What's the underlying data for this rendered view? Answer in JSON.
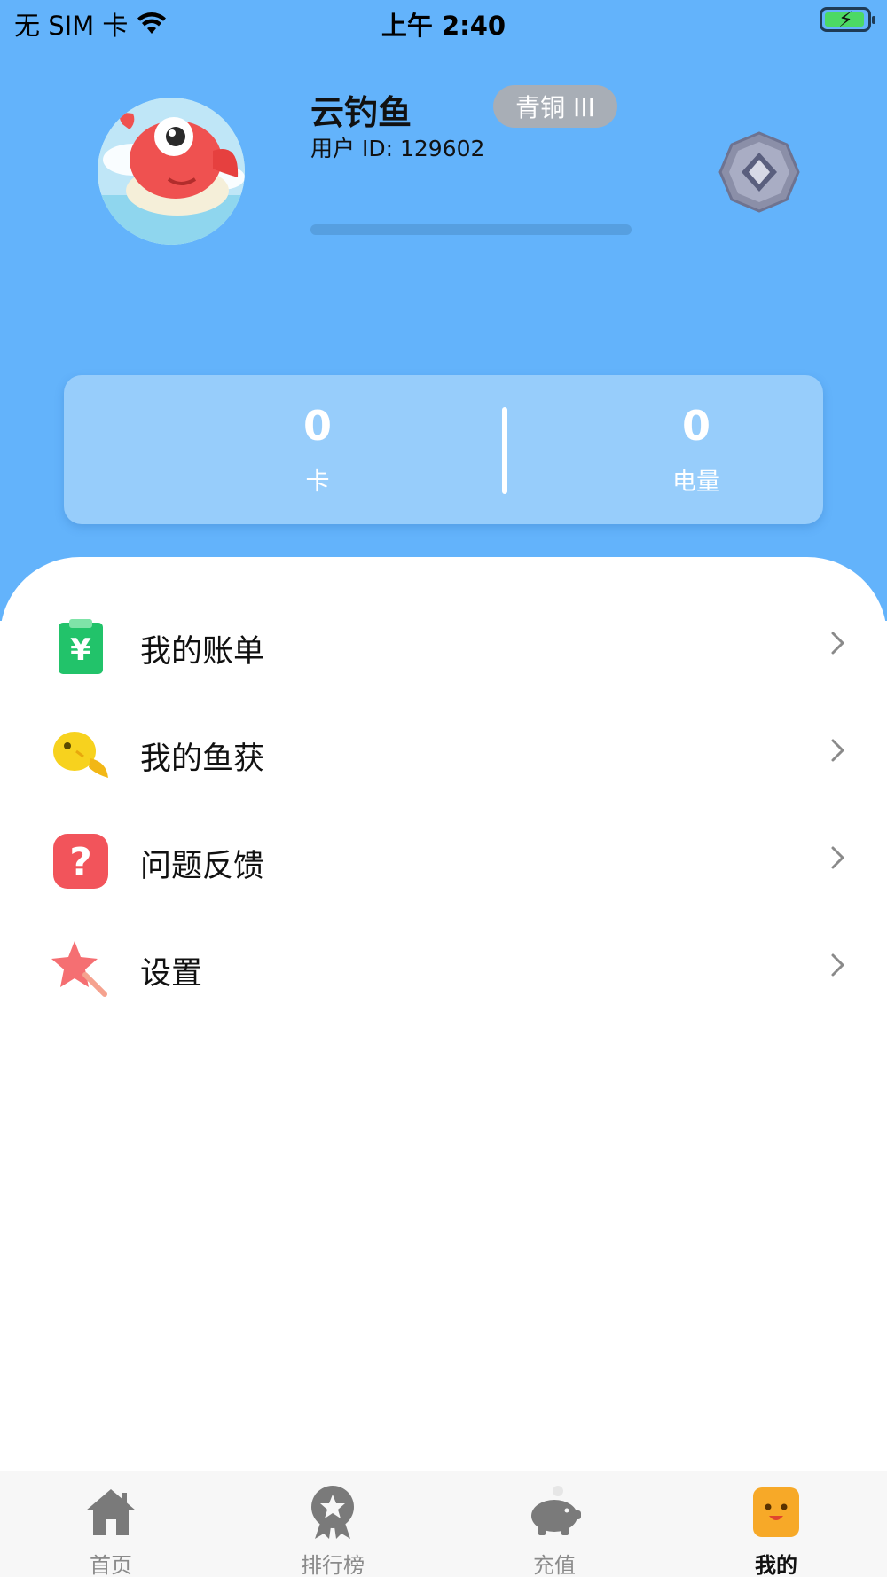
{
  "status_bar": {
    "carrier": "无 SIM 卡",
    "time": "上午 2:40"
  },
  "profile": {
    "username": "云钓鱼",
    "rank": "青铜 III",
    "user_id": "用户 ID: 129602",
    "progress": 0
  },
  "stats": [
    {
      "value": "0",
      "label": "卡"
    },
    {
      "value": "0",
      "label": "电量"
    }
  ],
  "menu": [
    {
      "label": "我的账单",
      "icon": "bill-icon"
    },
    {
      "label": "我的鱼获",
      "icon": "fish-catch-icon"
    },
    {
      "label": "问题反馈",
      "icon": "feedback-icon"
    },
    {
      "label": "设置",
      "icon": "settings-icon"
    }
  ],
  "tabs": [
    {
      "label": "首页",
      "icon": "home-icon",
      "active": false
    },
    {
      "label": "排行榜",
      "icon": "ranking-icon",
      "active": false
    },
    {
      "label": "充值",
      "icon": "piggy-bank-icon",
      "active": false
    },
    {
      "label": "我的",
      "icon": "profile-face-icon",
      "active": true
    }
  ],
  "colors": {
    "header_bg": "#63b3fb",
    "card_bg": "#97cdfb",
    "rank_badge": "#a8aeb6",
    "active_tab": "#f7a928"
  }
}
